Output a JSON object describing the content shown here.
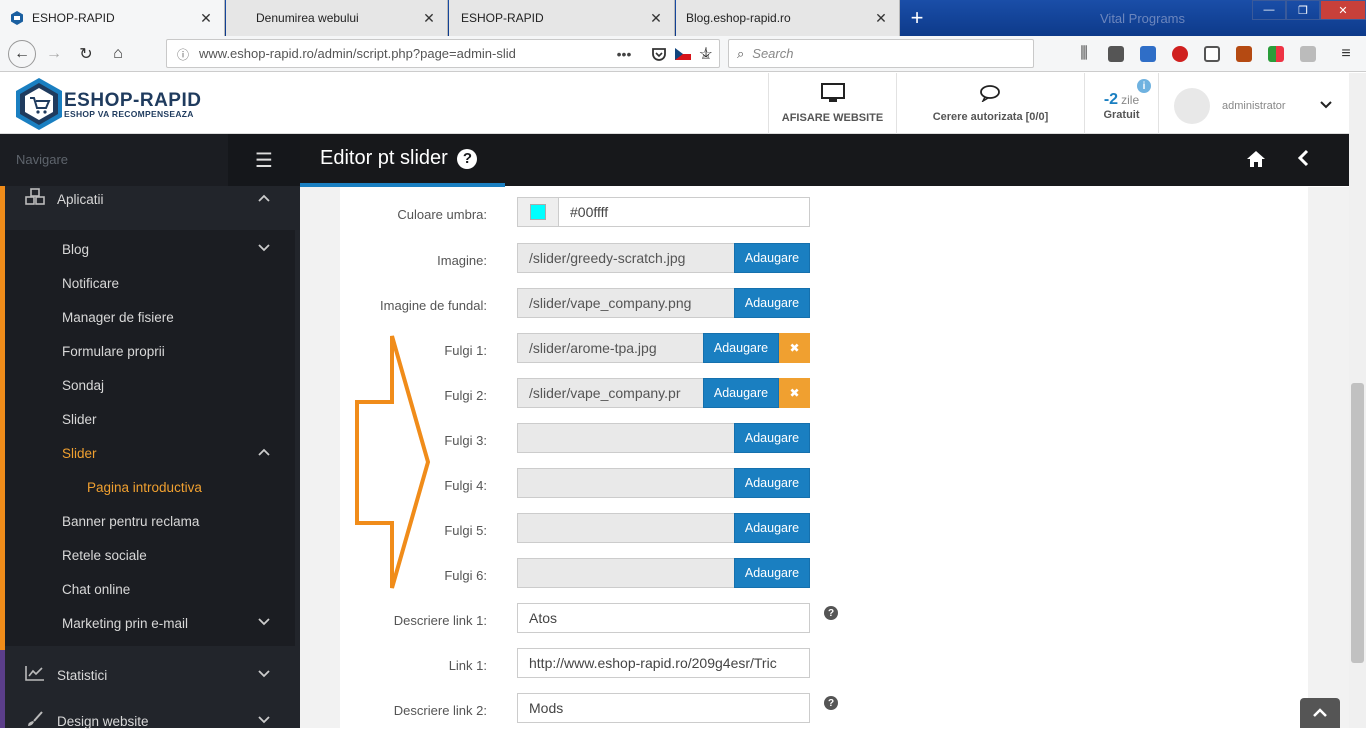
{
  "browser": {
    "tabs": [
      {
        "title": "ESHOP-RAPID",
        "active": true
      },
      {
        "title": "Denumirea webului",
        "active": false
      },
      {
        "title": "ESHOP-RAPID",
        "active": false
      },
      {
        "title": "Blog.eshop-rapid.ro",
        "active": false
      }
    ],
    "tab_close": "✕",
    "new_tab": "+",
    "tabbar_text": "Vital Programs",
    "url": "www.eshop-rapid.ro/admin/script.php?page=admin-slid",
    "search_placeholder": "Search",
    "window_controls": {
      "minimize": "—",
      "maximize": "❐",
      "close": "✕"
    }
  },
  "header": {
    "logo_title": "ESHOP-RAPID",
    "logo_subtitle": "ESHOP VA RECOMPENSEAZA",
    "view_website": "AFISARE WEBSITE",
    "auth_requests": "Cerere autorizata [0/0]",
    "days_value": "-2",
    "days_unit": "zile",
    "days_plan": "Gratuit",
    "admin_name": "administrator"
  },
  "sidebar": {
    "nav_label": "Navigare",
    "items": [
      {
        "label": "Aplicatii",
        "caret": "︿"
      },
      {
        "label": "Blog",
        "caret": "﹀"
      },
      {
        "label": "Notificare"
      },
      {
        "label": "Manager de fisiere"
      },
      {
        "label": "Formulare proprii"
      },
      {
        "label": "Sondaj"
      },
      {
        "label": "Slider"
      },
      {
        "label": "Slider",
        "caret": "︿"
      },
      {
        "label": "Pagina introductiva"
      },
      {
        "label": "Banner pentru reclama"
      },
      {
        "label": "Retele sociale"
      },
      {
        "label": "Chat online"
      },
      {
        "label": "Marketing prin e-mail",
        "caret": "﹀"
      },
      {
        "label": "Statistici",
        "caret": "﹀"
      },
      {
        "label": "Design website",
        "caret": "﹀"
      }
    ]
  },
  "main": {
    "title": "Editor pt slider",
    "title_help": "?",
    "add_label": "Adaugare",
    "remove_label": "✖",
    "help": "?",
    "shadow_color": {
      "label": "Culoare umbra:",
      "value": "#00ffff"
    },
    "image": {
      "label": "Imagine:",
      "value": "/slider/greedy-scratch.jpg"
    },
    "background": {
      "label": "Imagine de fundal:",
      "value": "/slider/vape_company.png"
    },
    "flakes": [
      {
        "label": "Fulgi 1:",
        "value": "/slider/arome-tpa.jpg"
      },
      {
        "label": "Fulgi 2:",
        "value": "/slider/vape_company.pr"
      },
      {
        "label": "Fulgi 3:",
        "value": ""
      },
      {
        "label": "Fulgi 4:",
        "value": ""
      },
      {
        "label": "Fulgi 5:",
        "value": ""
      },
      {
        "label": "Fulgi 6:",
        "value": ""
      }
    ],
    "link1_desc": {
      "label": "Descriere link 1:",
      "value": "Atos"
    },
    "link1": {
      "label": "Link 1:",
      "value": "http://www.eshop-rapid.ro/209g4esr/Tric"
    },
    "link2_desc": {
      "label": "Descriere link 2:",
      "value": "Mods"
    }
  },
  "colors": {
    "accent": "#1a7fc1",
    "orange": "#f08c1a",
    "sidebar_bg": "#22252b",
    "shadow_swatch": "#00ffff"
  }
}
